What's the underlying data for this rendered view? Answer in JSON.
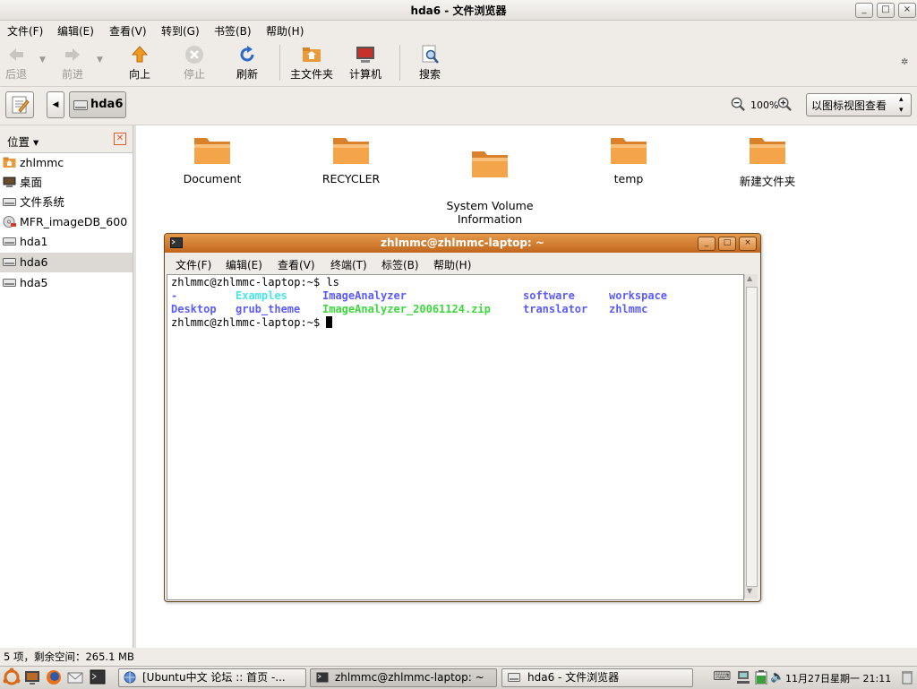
{
  "window": {
    "title": "hda6 - 文件浏览器",
    "controls": [
      "_",
      "□",
      "×"
    ]
  },
  "menu": [
    "文件(F)",
    "编辑(E)",
    "查看(V)",
    "转到(G)",
    "书签(B)",
    "帮助(H)"
  ],
  "toolbar": {
    "back": "后退",
    "forward": "前进",
    "up": "向上",
    "stop": "停止",
    "reload": "刷新",
    "home": "主文件夹",
    "computer": "计算机",
    "search": "搜索"
  },
  "location": {
    "path_button": "hda6",
    "zoom": "100%",
    "view_mode": "以图标视图查看"
  },
  "sidebar": {
    "title": "位置",
    "items": [
      {
        "label": "zhlmmc",
        "icon": "home-folder-icon"
      },
      {
        "label": "桌面",
        "icon": "desktop-icon"
      },
      {
        "label": "文件系统",
        "icon": "drive-icon"
      },
      {
        "label": "MFR_imageDB_600",
        "icon": "cdrom-icon"
      },
      {
        "label": "hda1",
        "icon": "drive-icon"
      },
      {
        "label": "hda6",
        "icon": "drive-icon"
      },
      {
        "label": "hda5",
        "icon": "drive-icon"
      }
    ]
  },
  "files": [
    {
      "name": "Document"
    },
    {
      "name": "RECYCLER"
    },
    {
      "name": "System Volume\nInformation"
    },
    {
      "name": "temp"
    },
    {
      "name": "新建文件夹"
    }
  ],
  "status": "5 项，剩余空间：265.1 MB",
  "terminal": {
    "title": "zhlmmc@zhlmmc-laptop: ~",
    "menu": [
      "文件(F)",
      "编辑(E)",
      "查看(V)",
      "终端(T)",
      "标签(B)",
      "帮助(H)"
    ],
    "prompt1": "zhlmmc@zhlmmc-laptop:~$ ls",
    "row1": [
      "-",
      "Examples",
      "ImageAnalyzer",
      "software",
      "workspace"
    ],
    "row2": [
      "Desktop",
      "grub_theme",
      "ImageAnalyzer_20061124.zip",
      "translator",
      "zhlmmc"
    ],
    "prompt2": "zhlmmc@zhlmmc-laptop:~$ ",
    "colors": {
      "dir": "#5b5bff",
      "link": "#49e6e6",
      "archive": "#3cd83c"
    }
  },
  "taskbar": {
    "tasks": [
      "[Ubuntu中文 论坛 :: 首页 -...",
      "zhlmmc@zhlmmc-laptop: ~",
      "hda6 - 文件浏览器"
    ],
    "clock": "11月27日星期一  21:11"
  },
  "colors": {
    "terminal_title": "#d07a2c",
    "folder": "#f0a040"
  }
}
